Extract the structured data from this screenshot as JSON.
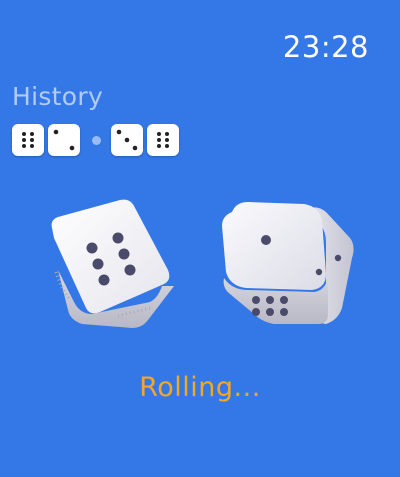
{
  "status_bar": {
    "time": "23:28"
  },
  "history": {
    "title": "History",
    "rolls": [
      {
        "dice": [
          6,
          2
        ]
      },
      {
        "dice": [
          3,
          6
        ]
      }
    ]
  },
  "current_roll": {
    "dice": [
      {
        "visible_faces": [
          6
        ]
      },
      {
        "visible_faces": [
          1,
          2,
          6
        ]
      }
    ],
    "status": "Rolling..."
  },
  "colors": {
    "background": "#3478e8",
    "status_text": "#f5a623",
    "pip": "#4a4a6a"
  }
}
